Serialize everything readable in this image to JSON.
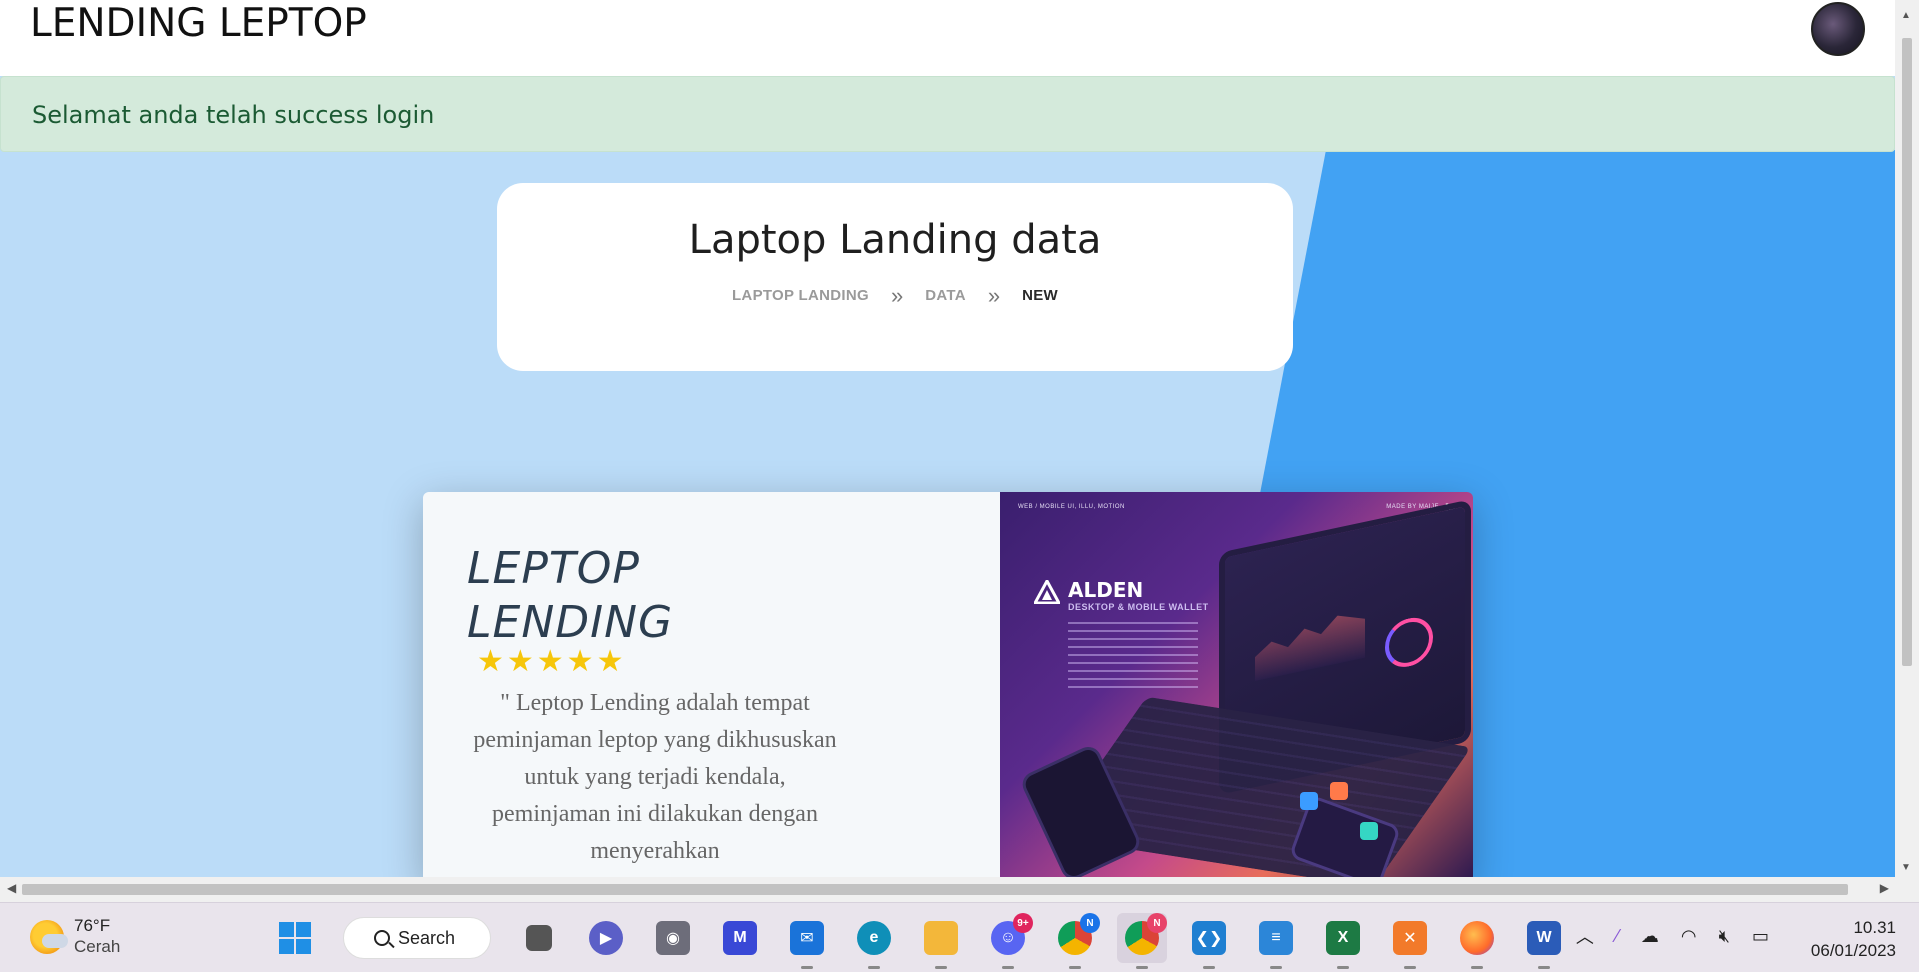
{
  "navbar": {
    "brand": "LENDING LEPTOP"
  },
  "alert": {
    "message": "Selamat anda telah success login"
  },
  "header_card": {
    "title": "Laptop Landing data",
    "breadcrumb": [
      "LAPTOP LANDING",
      "DATA",
      "NEW"
    ],
    "separator": "»"
  },
  "promo": {
    "title_line1": "LEPTOP",
    "title_line2": "LENDING",
    "rating": 5,
    "stars": "★★★★★",
    "quote": "\" Leptop Lending adalah tempat peminjaman leptop yang dikhususkan untuk yang terjadi kendala, peminjaman ini dilakukan dengan menyerahkan",
    "image": {
      "top_left": "WEB / MOBILE UI, ILLU, MOTION",
      "top_right": "MADE BY MAIJE",
      "brand": "ALDEN",
      "subtitle": "DESKTOP & MOBILE WALLET"
    }
  },
  "taskbar": {
    "weather": {
      "temp": "76°F",
      "condition": "Cerah"
    },
    "search_label": "Search",
    "apps": [
      {
        "name": "windows-start",
        "color": "#1f8fe5"
      },
      {
        "name": "task-view",
        "color": "#555"
      },
      {
        "name": "teams-chat",
        "color": "#5b5fc7"
      },
      {
        "name": "camera",
        "color": "#6d6d7a"
      },
      {
        "name": "visual-studio-ish",
        "color": "#3948d6"
      },
      {
        "name": "mail",
        "color": "#1a73d9"
      },
      {
        "name": "edge",
        "color": "#0f8fb8"
      },
      {
        "name": "file-explorer",
        "color": "#f3b73a"
      },
      {
        "name": "discord",
        "color": "#5865f2",
        "badge": "9+"
      },
      {
        "name": "chrome-profile-n-blue",
        "color": "#2d8f3c",
        "badge": "N"
      },
      {
        "name": "chrome-profile-n-red",
        "color": "#2d8f3c",
        "badge": "N"
      },
      {
        "name": "vscode",
        "color": "#1f7fd1"
      },
      {
        "name": "notepad",
        "color": "#2c86d8"
      },
      {
        "name": "excel",
        "color": "#1d7a44"
      },
      {
        "name": "xampp",
        "color": "#f27a2a"
      },
      {
        "name": "firefox",
        "color": "#ff6a2a"
      },
      {
        "name": "word",
        "color": "#2b5cb8"
      }
    ],
    "clock": {
      "time": "10.31",
      "date": "06/01/2023"
    }
  }
}
